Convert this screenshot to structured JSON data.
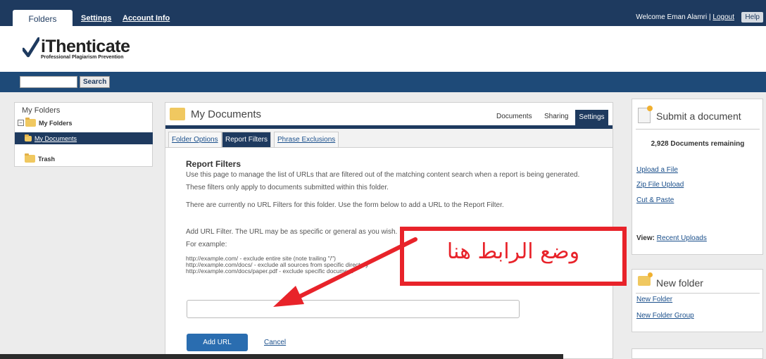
{
  "topnav": {
    "tabs": [
      "Folders",
      "Settings",
      "Account Info"
    ],
    "welcome": "Welcome Eman Alamri |",
    "logout": "Logout",
    "help": "Help"
  },
  "brand": {
    "name": "iThenticate",
    "tagline": "Professional Plagiarism Prevention"
  },
  "search": {
    "button": "Search",
    "value": ""
  },
  "sidebar": {
    "title": "My Folders",
    "group": "My Folders",
    "selected": "My Documents",
    "trash": "Trash"
  },
  "main": {
    "title": "My Documents",
    "tabs": [
      "Documents",
      "Sharing",
      "Settings"
    ],
    "subtabs": [
      "Folder Options",
      "Report Filters",
      "Phrase Exclusions"
    ],
    "heading": "Report Filters",
    "para1": "Use this page to manage the list of URLs that are filtered out of the matching content search when a report is being generated.",
    "para2": "These filters only apply to documents submitted within this folder.",
    "para3": "There are currently no URL Filters for this folder. Use the form below to add a URL to the Report Filter.",
    "para4": "Add URL Filter. The URL may be as specific or general as you wish.",
    "para5": "For example:",
    "examples": [
      "http://example.com/ - exclude entire site (note trailing \"/\")",
      "http://example.com/docs/ - exclude all sources from specific directory",
      "http://example.com/docs/paper.pdf - exclude specific document"
    ],
    "add_button": "Add URL",
    "cancel": "Cancel",
    "url_value": ""
  },
  "submit_panel": {
    "title": "Submit a document",
    "remaining": "2,928 Documents remaining",
    "links": [
      "Upload a File",
      "Zip File Upload",
      "Cut & Paste"
    ],
    "view_label": "View:",
    "view_link": "Recent Uploads"
  },
  "folder_panel": {
    "title": "New folder",
    "links": [
      "New Folder",
      "New Folder Group"
    ]
  },
  "annotation": {
    "text": "وضع الرابط هنا",
    "color": "#e8232a"
  }
}
